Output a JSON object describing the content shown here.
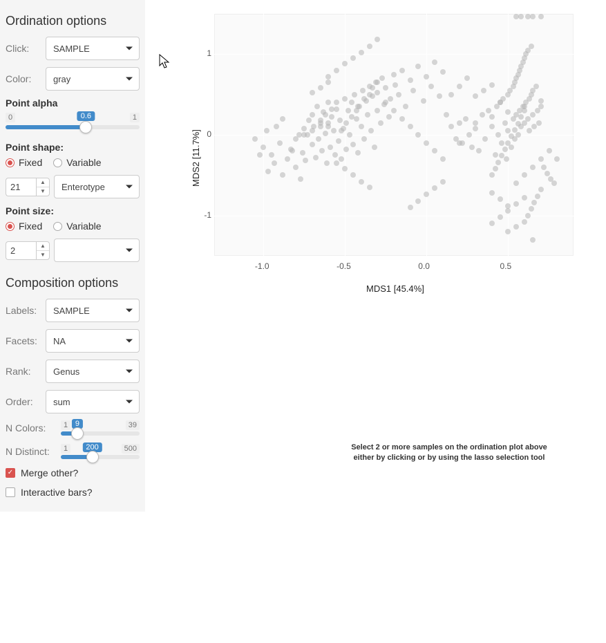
{
  "ordination": {
    "heading": "Ordination options",
    "click_label": "Click:",
    "click_value": "SAMPLE",
    "color_label": "Color:",
    "color_value": "gray",
    "alpha_label": "Point alpha",
    "alpha_min": "0",
    "alpha_max": "1",
    "alpha_value": "0.6",
    "alpha_pct": 60,
    "shape_label": "Point shape:",
    "shape_mode_fixed": "Fixed",
    "shape_mode_variable": "Variable",
    "shape_mode": "Fixed",
    "shape_fixed_value": "21",
    "shape_var_value": "Enterotype",
    "size_label": "Point size:",
    "size_mode": "Fixed",
    "size_fixed_value": "2",
    "size_var_value": ""
  },
  "composition": {
    "heading": "Composition options",
    "labels_label": "Labels:",
    "labels_value": "SAMPLE",
    "facets_label": "Facets:",
    "facets_value": "NA",
    "rank_label": "Rank:",
    "rank_value": "Genus",
    "order_label": "Order:",
    "order_value": "sum",
    "ncolors_label": "N Colors:",
    "ncolors_min": "1",
    "ncolors_max": "39",
    "ncolors_value": "9",
    "ncolors_pct": 21,
    "ndistinct_label": "N Distinct:",
    "ndistinct_min": "1",
    "ndistinct_max": "500",
    "ndistinct_value": "200",
    "ndistinct_pct": 40,
    "merge_label": "Merge other?",
    "merge_checked": true,
    "interactive_label": "Interactive bars?",
    "interactive_checked": false
  },
  "plot": {
    "xlabel": "MDS1 [45.4%]",
    "ylabel": "MDS2 [11.7%]",
    "x_ticks": [
      {
        "label": "-1.0",
        "v": -1.0
      },
      {
        "label": "-0.5",
        "v": -0.5
      },
      {
        "label": "0.0",
        "v": 0.0
      },
      {
        "label": "0.5",
        "v": 0.5
      }
    ],
    "y_ticks": [
      {
        "label": "-1",
        "v": -1
      },
      {
        "label": "0",
        "v": 0
      },
      {
        "label": "1",
        "v": 1
      }
    ],
    "xrange": [
      -1.3,
      0.9
    ],
    "yrange": [
      -1.5,
      1.5
    ],
    "instruction_l1": "Select 2 or more samples on the ordination plot above",
    "instruction_l2": "either by clicking or by using the lasso selection tool"
  },
  "chart_data": {
    "type": "scatter",
    "title": "",
    "xlabel": "MDS1 [45.4%]",
    "ylabel": "MDS2 [11.7%]",
    "xlim": [
      -1.3,
      0.9
    ],
    "ylim": [
      -1.5,
      1.5
    ],
    "x_ticks": [
      -1.0,
      -0.5,
      0.0,
      0.5
    ],
    "y_ticks": [
      -1,
      0,
      1
    ],
    "point_alpha": 0.6,
    "point_color": "gray",
    "series": [
      {
        "name": "samples",
        "x": [
          -1.05,
          -1.0,
          -0.98,
          -0.95,
          -0.92,
          -0.9,
          -0.88,
          -0.85,
          -0.83,
          -0.8,
          -0.78,
          -0.76,
          -0.75,
          -0.74,
          -0.72,
          -0.7,
          -0.7,
          -0.68,
          -0.67,
          -0.66,
          -0.65,
          -0.64,
          -0.63,
          -0.62,
          -0.61,
          -0.6,
          -0.6,
          -0.59,
          -0.58,
          -0.57,
          -0.56,
          -0.55,
          -0.54,
          -0.53,
          -0.52,
          -0.51,
          -0.5,
          -0.49,
          -0.48,
          -0.47,
          -0.46,
          -0.45,
          -0.44,
          -0.43,
          -0.42,
          -0.42,
          -0.4,
          -0.39,
          -0.38,
          -0.37,
          -0.36,
          -0.35,
          -0.34,
          -0.33,
          -0.32,
          -0.31,
          -0.3,
          -0.3,
          -0.28,
          -0.27,
          -0.26,
          -0.25,
          -0.23,
          -0.22,
          -0.2,
          -0.19,
          -0.17,
          -0.15,
          -0.13,
          -0.1,
          -0.08,
          -0.05,
          -0.02,
          0.0,
          0.03,
          0.05,
          0.08,
          0.1,
          0.12,
          0.15,
          0.18,
          0.2,
          0.22,
          0.24,
          0.26,
          0.28,
          0.3,
          0.32,
          0.34,
          0.36,
          0.38,
          0.4,
          0.42,
          0.43,
          0.44,
          0.45,
          0.46,
          0.47,
          0.48,
          0.49,
          0.5,
          0.5,
          0.51,
          0.52,
          0.53,
          0.53,
          0.54,
          0.54,
          0.55,
          0.55,
          0.56,
          0.56,
          0.57,
          0.57,
          0.58,
          0.58,
          0.59,
          0.59,
          0.6,
          0.6,
          0.61,
          0.61,
          0.62,
          0.62,
          0.63,
          0.63,
          0.64,
          0.64,
          0.65,
          0.65,
          0.66,
          0.67,
          0.68,
          0.69,
          0.7,
          0.72,
          0.74,
          0.76,
          0.78,
          0.8,
          -1.02,
          -0.97,
          -0.93,
          -0.88,
          -0.82,
          -0.77,
          -0.73,
          -0.69,
          -0.65,
          -0.62,
          -0.58,
          -0.55,
          -0.52,
          -0.49,
          -0.46,
          -0.43,
          -0.41,
          -0.38,
          -0.35,
          -0.33,
          -0.3,
          -0.6,
          -0.55,
          -0.5,
          -0.45,
          -0.4,
          -0.35,
          -0.3,
          -0.25,
          -0.2,
          -0.15,
          -0.1,
          -0.05,
          0.0,
          0.05,
          0.1,
          0.15,
          0.2,
          0.25,
          0.3,
          0.35,
          0.4,
          0.45,
          -0.7,
          -0.65,
          -0.6,
          -0.55,
          -0.5,
          -0.45,
          -0.4,
          -0.35,
          0.4,
          0.45,
          0.5,
          0.55,
          0.6,
          0.65,
          0.7,
          0.75,
          0.2,
          0.3,
          0.4,
          0.5,
          0.6,
          0.7,
          -0.8,
          -0.75,
          -0.7,
          -0.65,
          -0.6,
          -0.1,
          -0.05,
          0.0,
          0.05,
          0.1,
          0.4,
          0.42,
          0.44,
          0.46,
          0.48,
          0.5,
          0.52,
          0.54,
          0.56,
          0.58,
          0.6,
          0.62,
          0.64,
          0.66,
          0.68,
          0.7,
          0.4,
          0.45,
          0.5,
          0.55,
          0.6,
          0.5,
          0.55,
          0.6,
          0.65,
          0.7,
          0.55,
          0.58,
          0.62,
          0.65
        ],
        "y": [
          -0.05,
          -0.15,
          0.05,
          -0.25,
          0.1,
          -0.1,
          0.2,
          -0.3,
          -0.18,
          -0.4,
          0.0,
          -0.22,
          0.08,
          -0.32,
          0.18,
          -0.12,
          0.25,
          -0.28,
          0.35,
          -0.05,
          0.15,
          -0.2,
          0.28,
          0.02,
          -0.35,
          0.4,
          0.1,
          -0.15,
          0.22,
          0.05,
          -0.25,
          0.32,
          -0.08,
          0.18,
          -0.3,
          0.08,
          0.45,
          -0.18,
          0.3,
          0.0,
          0.4,
          -0.12,
          0.5,
          0.2,
          -0.22,
          0.35,
          0.1,
          0.55,
          -0.05,
          0.42,
          0.25,
          0.6,
          0.05,
          0.48,
          -0.15,
          0.65,
          0.3,
          0.52,
          0.15,
          0.7,
          0.38,
          0.58,
          0.22,
          0.45,
          0.75,
          0.62,
          0.5,
          0.8,
          0.35,
          0.68,
          0.55,
          0.85,
          0.42,
          0.72,
          0.6,
          0.9,
          0.48,
          0.78,
          0.25,
          0.1,
          -0.05,
          0.15,
          -0.1,
          0.2,
          0.0,
          -0.15,
          0.08,
          -0.2,
          0.25,
          -0.05,
          0.3,
          0.1,
          -0.25,
          0.35,
          0.0,
          0.4,
          -0.1,
          0.45,
          0.15,
          -0.3,
          0.5,
          0.05,
          0.55,
          -0.15,
          0.6,
          0.2,
          0.65,
          -0.05,
          0.7,
          0.25,
          0.75,
          0.0,
          0.8,
          0.3,
          0.85,
          0.1,
          0.9,
          0.35,
          0.95,
          0.15,
          1.0,
          0.4,
          1.05,
          0.2,
          0.45,
          0.05,
          1.1,
          0.5,
          0.25,
          0.55,
          0.1,
          0.6,
          0.3,
          0.15,
          0.35,
          -0.4,
          -0.48,
          -0.55,
          -0.6,
          -0.3,
          -0.25,
          -0.45,
          -0.35,
          -0.5,
          -0.2,
          -0.55,
          0.0,
          0.1,
          0.18,
          0.25,
          0.32,
          0.4,
          0.05,
          0.15,
          0.22,
          0.3,
          0.35,
          0.45,
          0.5,
          0.58,
          0.65,
          0.72,
          0.8,
          0.88,
          0.95,
          1.02,
          1.1,
          1.18,
          0.4,
          0.3,
          0.2,
          0.1,
          0.0,
          -0.1,
          -0.2,
          -0.3,
          0.5,
          0.6,
          0.7,
          0.48,
          0.55,
          0.62,
          0.4,
          0.52,
          0.58,
          0.65,
          -0.35,
          -0.42,
          -0.5,
          -0.58,
          -0.65,
          -0.72,
          -0.8,
          -0.88,
          -0.6,
          -0.5,
          -0.4,
          -0.3,
          -0.2,
          -0.1,
          0.15,
          0.22,
          0.28,
          0.35,
          0.42,
          -0.05,
          0.0,
          0.05,
          0.1,
          0.15,
          -0.9,
          -0.82,
          -0.74,
          -0.66,
          -0.58,
          -0.5,
          -0.42,
          -0.34,
          -0.26,
          -0.18,
          -0.1,
          -0.02,
          0.06,
          0.14,
          0.22,
          0.3,
          -1.0,
          -0.92,
          -0.84,
          -0.76,
          -0.68,
          -1.1,
          -1.02,
          -0.94,
          -0.86,
          -0.78,
          -1.2,
          -1.14,
          -1.08,
          -1.3
        ]
      }
    ]
  }
}
